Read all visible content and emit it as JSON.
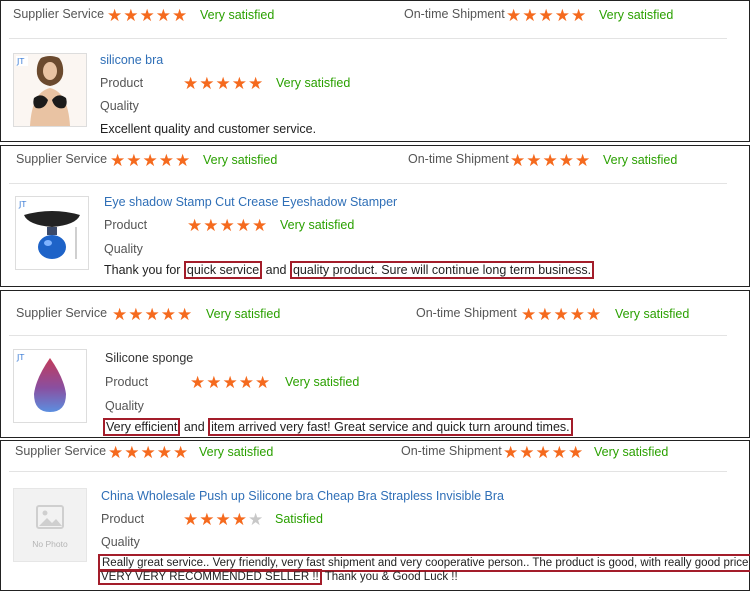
{
  "colors": {
    "star": "#f56a1e",
    "satisfied": "#2aa000",
    "highlight": "#a31d2a",
    "link": "#2f6fb7"
  },
  "labels": {
    "supplier_service": "Supplier Service",
    "ontime_shipment": "On-time Shipment",
    "product": "Product",
    "quality": "Quality",
    "no_photo": "No Photo"
  },
  "reviews": [
    {
      "supplier_rating": 5,
      "supplier_text": "Very satisfied",
      "shipment_rating": 5,
      "shipment_text": "Very satisfied",
      "product_title": "silicone bra",
      "product_rating": 5,
      "product_text": "Very satisfied",
      "image_icon": "bra-product-photo",
      "comment": "Excellent quality and customer service."
    },
    {
      "supplier_rating": 5,
      "supplier_text": "Very satisfied",
      "shipment_rating": 5,
      "shipment_text": "Very satisfied",
      "product_title": "Eye shadow Stamp Cut Crease Eyeshadow Stamper",
      "product_rating": 5,
      "product_text": "Very satisfied",
      "image_icon": "eyeshadow-stamper-photo",
      "comment_parts": [
        "Thank you for ",
        "quick service",
        " and ",
        "quality product. Sure will continue long term business."
      ]
    },
    {
      "supplier_rating": 5,
      "supplier_text": "Very satisfied",
      "shipment_rating": 5,
      "shipment_text": "Very satisfied",
      "product_title": "Silicone sponge",
      "product_rating": 5,
      "product_text": "Very satisfied",
      "image_icon": "silicone-sponge-photo",
      "comment_parts": [
        "Very efficient",
        " and ",
        "item arrived very fast! Great service and quick turn around times."
      ]
    },
    {
      "supplier_rating": 5,
      "supplier_text": "Very satisfied",
      "shipment_rating": 5,
      "shipment_text": "Very satisfied",
      "product_title": "China Wholesale Push up Silicone bra Cheap Bra Strapless Invisible Bra",
      "product_rating": 4,
      "product_text": "Satisfied",
      "image_icon": "no-photo-icon",
      "comment_line1": "Really great service.. Very friendly, very fast shipment and very cooperative person.. The product is good, with really good price..",
      "comment_line2_hl": "VERY VERY RECOMMENDED SELLER !!",
      "comment_line2_rest": " Thank you & Good Luck !!"
    }
  ]
}
